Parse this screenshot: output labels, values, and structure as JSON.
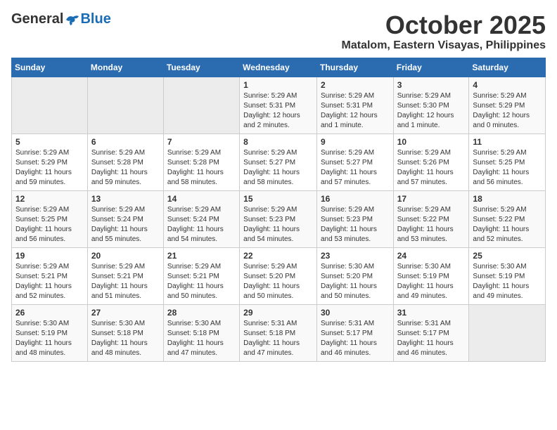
{
  "header": {
    "logo_general": "General",
    "logo_blue": "Blue",
    "month": "October 2025",
    "location": "Matalom, Eastern Visayas, Philippines"
  },
  "weekdays": [
    "Sunday",
    "Monday",
    "Tuesday",
    "Wednesday",
    "Thursday",
    "Friday",
    "Saturday"
  ],
  "weeks": [
    [
      {
        "day": "",
        "sunrise": "",
        "sunset": "",
        "daylight": ""
      },
      {
        "day": "",
        "sunrise": "",
        "sunset": "",
        "daylight": ""
      },
      {
        "day": "",
        "sunrise": "",
        "sunset": "",
        "daylight": ""
      },
      {
        "day": "1",
        "sunrise": "Sunrise: 5:29 AM",
        "sunset": "Sunset: 5:31 PM",
        "daylight": "Daylight: 12 hours and 2 minutes."
      },
      {
        "day": "2",
        "sunrise": "Sunrise: 5:29 AM",
        "sunset": "Sunset: 5:31 PM",
        "daylight": "Daylight: 12 hours and 1 minute."
      },
      {
        "day": "3",
        "sunrise": "Sunrise: 5:29 AM",
        "sunset": "Sunset: 5:30 PM",
        "daylight": "Daylight: 12 hours and 1 minute."
      },
      {
        "day": "4",
        "sunrise": "Sunrise: 5:29 AM",
        "sunset": "Sunset: 5:29 PM",
        "daylight": "Daylight: 12 hours and 0 minutes."
      }
    ],
    [
      {
        "day": "5",
        "sunrise": "Sunrise: 5:29 AM",
        "sunset": "Sunset: 5:29 PM",
        "daylight": "Daylight: 11 hours and 59 minutes."
      },
      {
        "day": "6",
        "sunrise": "Sunrise: 5:29 AM",
        "sunset": "Sunset: 5:28 PM",
        "daylight": "Daylight: 11 hours and 59 minutes."
      },
      {
        "day": "7",
        "sunrise": "Sunrise: 5:29 AM",
        "sunset": "Sunset: 5:28 PM",
        "daylight": "Daylight: 11 hours and 58 minutes."
      },
      {
        "day": "8",
        "sunrise": "Sunrise: 5:29 AM",
        "sunset": "Sunset: 5:27 PM",
        "daylight": "Daylight: 11 hours and 58 minutes."
      },
      {
        "day": "9",
        "sunrise": "Sunrise: 5:29 AM",
        "sunset": "Sunset: 5:27 PM",
        "daylight": "Daylight: 11 hours and 57 minutes."
      },
      {
        "day": "10",
        "sunrise": "Sunrise: 5:29 AM",
        "sunset": "Sunset: 5:26 PM",
        "daylight": "Daylight: 11 hours and 57 minutes."
      },
      {
        "day": "11",
        "sunrise": "Sunrise: 5:29 AM",
        "sunset": "Sunset: 5:25 PM",
        "daylight": "Daylight: 11 hours and 56 minutes."
      }
    ],
    [
      {
        "day": "12",
        "sunrise": "Sunrise: 5:29 AM",
        "sunset": "Sunset: 5:25 PM",
        "daylight": "Daylight: 11 hours and 56 minutes."
      },
      {
        "day": "13",
        "sunrise": "Sunrise: 5:29 AM",
        "sunset": "Sunset: 5:24 PM",
        "daylight": "Daylight: 11 hours and 55 minutes."
      },
      {
        "day": "14",
        "sunrise": "Sunrise: 5:29 AM",
        "sunset": "Sunset: 5:24 PM",
        "daylight": "Daylight: 11 hours and 54 minutes."
      },
      {
        "day": "15",
        "sunrise": "Sunrise: 5:29 AM",
        "sunset": "Sunset: 5:23 PM",
        "daylight": "Daylight: 11 hours and 54 minutes."
      },
      {
        "day": "16",
        "sunrise": "Sunrise: 5:29 AM",
        "sunset": "Sunset: 5:23 PM",
        "daylight": "Daylight: 11 hours and 53 minutes."
      },
      {
        "day": "17",
        "sunrise": "Sunrise: 5:29 AM",
        "sunset": "Sunset: 5:22 PM",
        "daylight": "Daylight: 11 hours and 53 minutes."
      },
      {
        "day": "18",
        "sunrise": "Sunrise: 5:29 AM",
        "sunset": "Sunset: 5:22 PM",
        "daylight": "Daylight: 11 hours and 52 minutes."
      }
    ],
    [
      {
        "day": "19",
        "sunrise": "Sunrise: 5:29 AM",
        "sunset": "Sunset: 5:21 PM",
        "daylight": "Daylight: 11 hours and 52 minutes."
      },
      {
        "day": "20",
        "sunrise": "Sunrise: 5:29 AM",
        "sunset": "Sunset: 5:21 PM",
        "daylight": "Daylight: 11 hours and 51 minutes."
      },
      {
        "day": "21",
        "sunrise": "Sunrise: 5:29 AM",
        "sunset": "Sunset: 5:21 PM",
        "daylight": "Daylight: 11 hours and 50 minutes."
      },
      {
        "day": "22",
        "sunrise": "Sunrise: 5:29 AM",
        "sunset": "Sunset: 5:20 PM",
        "daylight": "Daylight: 11 hours and 50 minutes."
      },
      {
        "day": "23",
        "sunrise": "Sunrise: 5:30 AM",
        "sunset": "Sunset: 5:20 PM",
        "daylight": "Daylight: 11 hours and 50 minutes."
      },
      {
        "day": "24",
        "sunrise": "Sunrise: 5:30 AM",
        "sunset": "Sunset: 5:19 PM",
        "daylight": "Daylight: 11 hours and 49 minutes."
      },
      {
        "day": "25",
        "sunrise": "Sunrise: 5:30 AM",
        "sunset": "Sunset: 5:19 PM",
        "daylight": "Daylight: 11 hours and 49 minutes."
      }
    ],
    [
      {
        "day": "26",
        "sunrise": "Sunrise: 5:30 AM",
        "sunset": "Sunset: 5:19 PM",
        "daylight": "Daylight: 11 hours and 48 minutes."
      },
      {
        "day": "27",
        "sunrise": "Sunrise: 5:30 AM",
        "sunset": "Sunset: 5:18 PM",
        "daylight": "Daylight: 11 hours and 48 minutes."
      },
      {
        "day": "28",
        "sunrise": "Sunrise: 5:30 AM",
        "sunset": "Sunset: 5:18 PM",
        "daylight": "Daylight: 11 hours and 47 minutes."
      },
      {
        "day": "29",
        "sunrise": "Sunrise: 5:31 AM",
        "sunset": "Sunset: 5:18 PM",
        "daylight": "Daylight: 11 hours and 47 minutes."
      },
      {
        "day": "30",
        "sunrise": "Sunrise: 5:31 AM",
        "sunset": "Sunset: 5:17 PM",
        "daylight": "Daylight: 11 hours and 46 minutes."
      },
      {
        "day": "31",
        "sunrise": "Sunrise: 5:31 AM",
        "sunset": "Sunset: 5:17 PM",
        "daylight": "Daylight: 11 hours and 46 minutes."
      },
      {
        "day": "",
        "sunrise": "",
        "sunset": "",
        "daylight": ""
      }
    ]
  ]
}
